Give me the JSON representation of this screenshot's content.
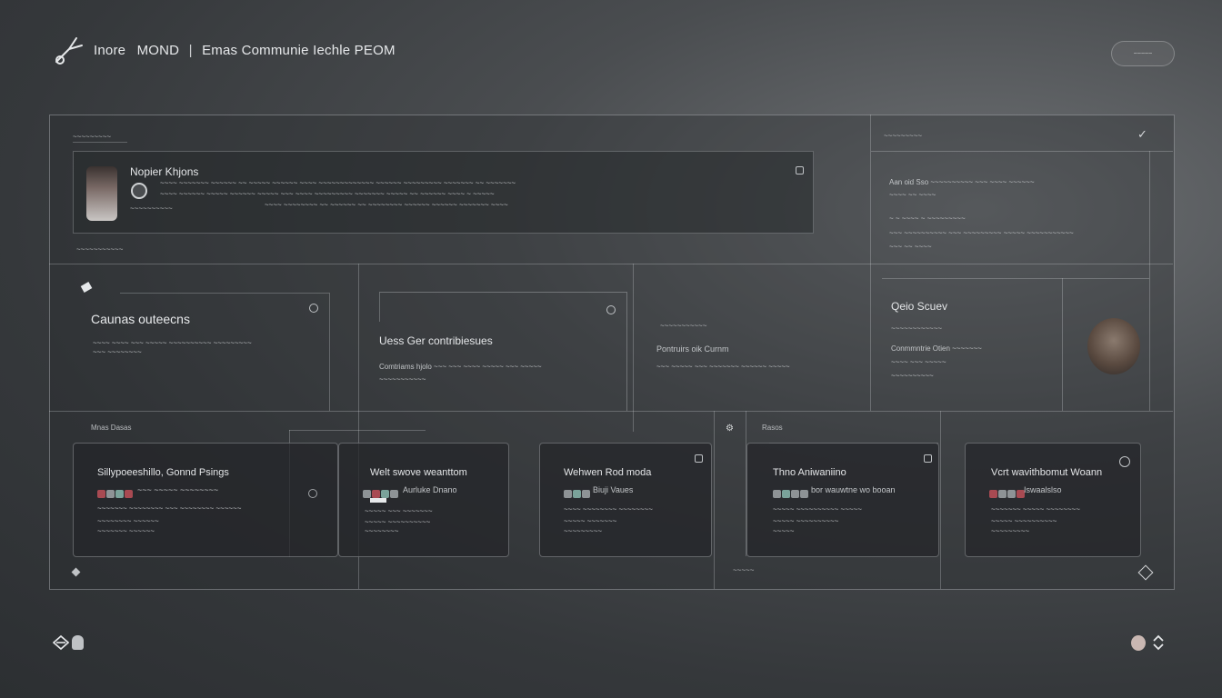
{
  "header": {
    "brand_a": "Inore",
    "brand_b": "MOND",
    "title": "Emas Communie Iechle PEOM",
    "pill_label": "~~~~~"
  },
  "top_section": {
    "label": "~~~~~~~~~",
    "post": {
      "name": "Nopier Khjons",
      "line1": "~~~~ ~~~~~~~ ~~~~~~ ~~ ~~~~~ ~~~~~~ ~~~~ ~~~~~~~~~~~~~ ~~~~~~ ~~~~~~~~~ ~~~~~~~ ~~ ~~~~~~~",
      "line2": "~~~~ ~~~~~~ ~~~~~ ~~~~~~ ~~~~~ ~~~ ~~~~ ~~~~~~~~~ ~~~~~~~ ~~~~~ ~~ ~~~~~~ ~~~~ ~ ~~~~~",
      "line3": "~~~~ ~~~~~~~~ ~~ ~~~~~~ ~~ ~~~~~~~~ ~~~~~~ ~~~~~~ ~~~~~~~ ~~~~",
      "meta": "~~~~~~~~~~"
    },
    "sub_label": "~~~~~~~~~~~"
  },
  "right_top": {
    "label": "~~~~~~~~~",
    "line1": "Aan oid Sso ~~~~~~~~~~ ~~~ ~~~~ ~~~~~~",
    "line2": "~~~~ ~~ ~~~~",
    "line3": "~ ~ ~~~~ ~ ~~~~~~~~~",
    "line4": "~~~ ~~~~~~~~~~ ~~~ ~~~~~~~~~ ~~~~~ ~~~~~~~~~~~",
    "line5": "~~~ ~~ ~~~~"
  },
  "mid": {
    "card1": {
      "title": "Caunas outeecns",
      "line1": "~~~~ ~~~~ ~~~ ~~~~~ ~~~~~~~~~~ ~~~~~~~~~",
      "line2": "~~~ ~~~~~~~~"
    },
    "card2": {
      "title": "Uess Ger contribiesues",
      "line1": "Comtriams hjolo ~~~ ~~~ ~~~~ ~~~~~ ~~~ ~~~~~",
      "line2": "~~~~~~~~~~~"
    },
    "card3": {
      "label": "~~~~~~~~~~~",
      "line1": "Pontruirs   oik   Curnm",
      "line2": "~~~ ~~~~~ ~~~ ~~~~~~~ ~~~~~~ ~~~~~"
    },
    "profile": {
      "name": "Qeio Scuev",
      "sub": "~~~~~~~~~~~~",
      "line1": "Conmmntrie Otien ~~~~~~~",
      "line2": "~~~~ ~~~ ~~~~~",
      "line3": "~~~~~~~~~~"
    }
  },
  "bottom": {
    "label_left": "Mnas Dasas",
    "label_right": "Rasos",
    "footer_label": "~~~~~",
    "cards": [
      {
        "title": "Sillypoeeshillo, Gonnd Psings",
        "tag": "~~~ ~~~~~ ~~~~~~~~",
        "line1": "~~~~~~~ ~~~~~~~~ ~~~ ~~~~~~~~ ~~~~~~",
        "line2": "~~~~~~~~ ~~~~~~",
        "line3": "~~~~~~~ ~~~~~~"
      },
      {
        "title": "Welt swove weanttom",
        "tag": "Aurluke Dnano",
        "line1": "~~~~~ ~~~ ~~~~~~~",
        "line2": "~~~~~ ~~~~~~~~~~",
        "line3": "~~~~~~~~"
      },
      {
        "title": "Wehwen Rod moda",
        "tag": "Biuji Vaues",
        "line1": "~~~~ ~~~~~~~~ ~~~~~~~~",
        "line2": "~~~~~ ~~~~~~~",
        "line3": "~~~~~~~~~"
      },
      {
        "title": "Thno  Aniwaniino",
        "tag": "bor wauwtne wo booan",
        "line1": "~~~~~ ~~~~~~~~~~ ~~~~~",
        "line2": "~~~~~ ~~~~~~~~~~",
        "line3": "~~~~~"
      },
      {
        "title": "Vcrt wavithbomut Woann",
        "tag": "Iswaalslso",
        "line1": "~~~~~~~ ~~~~~ ~~~~~~~~",
        "line2": "~~~~~ ~~~~~~~~~~",
        "line3": "~~~~~~~~~"
      }
    ]
  },
  "colors": {
    "chip_red": "#a84a52",
    "chip_gray": "#8e9396",
    "chip_teal": "#7aa29a"
  }
}
